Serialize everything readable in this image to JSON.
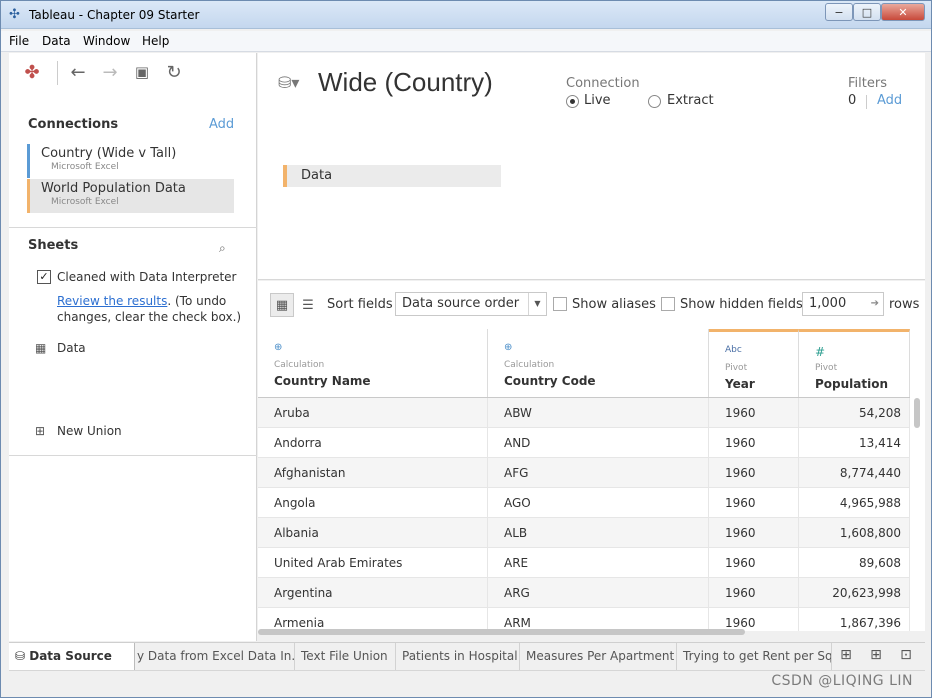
{
  "window": {
    "title": "Tableau - Chapter 09 Starter",
    "min": "−",
    "max": "□",
    "close": "✕"
  },
  "menu": [
    "File",
    "Data",
    "Window",
    "Help"
  ],
  "left": {
    "connections_title": "Connections",
    "add": "Add",
    "connections": [
      {
        "name": "Country (Wide v Tall)",
        "type": "Microsoft Excel"
      },
      {
        "name": "World Population Data",
        "type": "Microsoft Excel"
      }
    ],
    "sheets_title": "Sheets",
    "cleaned_label": "Cleaned with Data Interpreter",
    "review_link": "Review the results",
    "review_rest": ". (To undo changes, clear the check box.)",
    "sheet_data": "Data",
    "new_union": "New Union"
  },
  "datasource": {
    "title": "Wide (Country)",
    "connection_label": "Connection",
    "live": "Live",
    "extract": "Extract",
    "connection_mode": "Live",
    "filters_label": "Filters",
    "filters_count": "0",
    "filters_add": "Add",
    "table_chip": "Data"
  },
  "grid_toolbar": {
    "sort_label": "Sort fields",
    "sort_value": "Data source order",
    "show_aliases": "Show aliases",
    "show_hidden": "Show hidden fields",
    "rows_value": "1,000",
    "rows_label": "rows"
  },
  "columns": [
    {
      "type_icon": "globe-icon",
      "type_glyph": "⊕",
      "kind": "Calculation",
      "name": "Country Name"
    },
    {
      "type_icon": "globe-icon",
      "type_glyph": "⊕",
      "kind": "Calculation",
      "name": "Country Code"
    },
    {
      "type_icon": "abc-icon",
      "type_glyph": "Abc",
      "kind": "Pivot",
      "name": "Year"
    },
    {
      "type_icon": "number-icon",
      "type_glyph": "#",
      "kind": "Pivot",
      "name": "Population"
    }
  ],
  "rows": [
    [
      "Aruba",
      "ABW",
      "1960",
      "54,208"
    ],
    [
      "Andorra",
      "AND",
      "1960",
      "13,414"
    ],
    [
      "Afghanistan",
      "AFG",
      "1960",
      "8,774,440"
    ],
    [
      "Angola",
      "AGO",
      "1960",
      "4,965,988"
    ],
    [
      "Albania",
      "ALB",
      "1960",
      "1,608,800"
    ],
    [
      "United Arab Emirates",
      "ARE",
      "1960",
      "89,608"
    ],
    [
      "Argentina",
      "ARG",
      "1960",
      "20,623,998"
    ],
    [
      "Armenia",
      "ARM",
      "1960",
      "1,867,396"
    ]
  ],
  "tabs": [
    "Data Source",
    "y Data from Excel Data In...",
    "Text File Union",
    "Patients in Hospital",
    "Measures Per Apartment",
    "Trying to get Rent per Squ..."
  ],
  "watermark": "CSDN @LIQING LIN",
  "colors": {
    "accent_blue": "#5b9bd5",
    "accent_orange": "#f2b36b"
  }
}
